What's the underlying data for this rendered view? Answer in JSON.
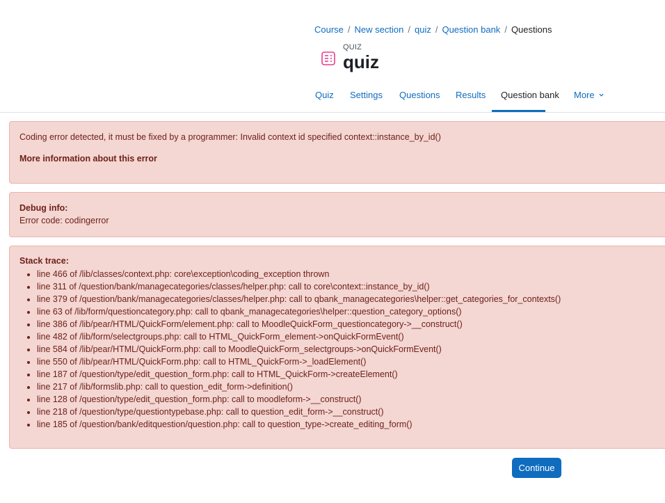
{
  "breadcrumb": {
    "items": [
      "Course",
      "New section",
      "quiz",
      "Question bank"
    ],
    "current": "Questions",
    "separator": "/"
  },
  "header": {
    "activity_type": "QUIZ",
    "title": "quiz",
    "icon": "quiz-icon",
    "icon_color": "#e83e8c"
  },
  "nav": {
    "tabs": [
      "Quiz",
      "Settings",
      "Questions",
      "Results",
      "Question bank"
    ],
    "active": "Question bank",
    "more": "More"
  },
  "error": {
    "message": "Coding error detected, it must be fixed by a programmer: Invalid context id specified context::instance_by_id()",
    "more_info": "More information about this error"
  },
  "debug": {
    "heading": "Debug info:",
    "code": "Error code: codingerror"
  },
  "stack": {
    "heading": "Stack trace:",
    "lines": [
      "line 466 of /lib/classes/context.php: core\\exception\\coding_exception thrown",
      "line 311 of /question/bank/managecategories/classes/helper.php: call to core\\context::instance_by_id()",
      "line 379 of /question/bank/managecategories/classes/helper.php: call to qbank_managecategories\\helper::get_categories_for_contexts()",
      "line 63 of /lib/form/questioncategory.php: call to qbank_managecategories\\helper::question_category_options()",
      "line 386 of /lib/pear/HTML/QuickForm/element.php: call to MoodleQuickForm_questioncategory->__construct()",
      "line 482 of /lib/form/selectgroups.php: call to HTML_QuickForm_element->onQuickFormEvent()",
      "line 584 of /lib/pear/HTML/QuickForm.php: call to MoodleQuickForm_selectgroups->onQuickFormEvent()",
      "line 550 of /lib/pear/HTML/QuickForm.php: call to HTML_QuickForm->_loadElement()",
      "line 187 of /question/type/edit_question_form.php: call to HTML_QuickForm->createElement()",
      "line 217 of /lib/formslib.php: call to question_edit_form->definition()",
      "line 128 of /question/type/edit_question_form.php: call to moodleform->__construct()",
      "line 218 of /question/type/questiontypebase.php: call to question_edit_form->__construct()",
      "line 185 of /question/bank/editquestion/question.php: call to question_type->create_editing_form()"
    ]
  },
  "continue_label": "Continue",
  "colors": {
    "link": "#0f6cbf",
    "alert_bg": "#f4d6d2",
    "alert_border": "#eeb3aa",
    "alert_text": "#6e211a",
    "button_bg": "#0f6cbf"
  }
}
